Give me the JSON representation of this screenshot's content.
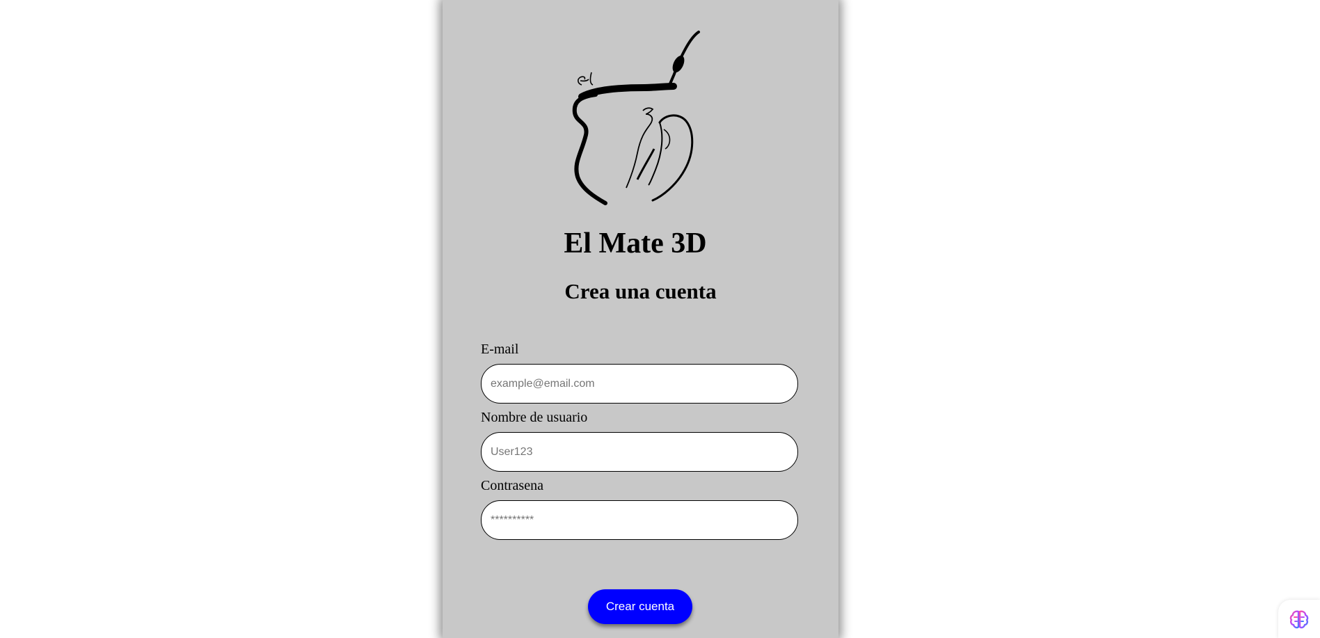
{
  "brand": {
    "name": "El Mate 3D",
    "logo_icon": "mate-cup-logo-icon"
  },
  "form": {
    "heading": "Crea una cuenta",
    "email": {
      "label": "E-mail",
      "placeholder": "example@email.com",
      "value": ""
    },
    "username": {
      "label": "Nombre de usuario",
      "placeholder": "User123",
      "value": ""
    },
    "password": {
      "label": "Contrasena",
      "placeholder": "**********",
      "value": ""
    },
    "submit_label": "Crear cuenta"
  },
  "colors": {
    "card_background": "#c8c8c8",
    "page_background": "#ffffff",
    "button_background": "#0000ff",
    "button_text": "#ffffff"
  },
  "assistant_widget": {
    "icon": "brain-icon"
  }
}
